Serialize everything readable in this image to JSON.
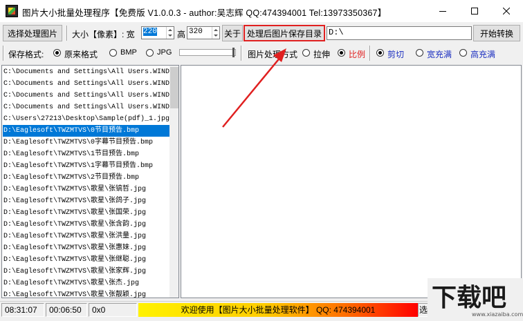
{
  "window": {
    "title": "图片大小批量处理程序【免费版 V1.0.0.3 - author:吴志辉  QQ:474394001 Tel:13973350367】",
    "controls": [
      "minimize",
      "maximize",
      "close"
    ]
  },
  "toolbar": {
    "choose_images_label": "选择处理图片",
    "size_label": "大小【像素】: 宽",
    "width_value": "220",
    "height_label": "高",
    "height_value": "320",
    "about_label": "关于",
    "output_dir_label": "处理后图片保存目录",
    "output_dir_value": "D:\\",
    "start_label": "开始转换"
  },
  "options": {
    "format_label": "保存格式:",
    "format_original": "原来格式",
    "format_bmp": "BMP",
    "format_jpg": "JPG",
    "selected_format": "原来格式",
    "method_label": "图片处理方式",
    "method_stretch": "拉伸",
    "method_ratio": "比例",
    "selected_method": "比例",
    "fill_crop": "剪切",
    "fill_width": "宽充满",
    "fill_height": "高充满",
    "selected_fill": "剪切"
  },
  "file_list": {
    "items": [
      "C:\\Documents and Settings\\All Users.WINDOWS",
      "C:\\Documents and Settings\\All Users.WINDOWS",
      "C:\\Documents and Settings\\All Users.WINDOWS",
      "C:\\Documents and Settings\\All Users.WINDOWS",
      "C:\\Users\\27213\\Desktop\\Sample(pdf)_1.jpg",
      "D:\\Eaglesoft\\TWZMTVS\\0节目预告.bmp",
      "D:\\Eaglesoft\\TWZMTVS\\0字幕节目预告.bmp",
      "D:\\Eaglesoft\\TWZMTVS\\1节目预告.bmp",
      "D:\\Eaglesoft\\TWZMTVS\\1字幕节目预告.bmp",
      "D:\\Eaglesoft\\TWZMTVS\\2节目预告.bmp",
      "D:\\Eaglesoft\\TWZMTVS\\歌星\\张镐哲.jpg",
      "D:\\Eaglesoft\\TWZMTVS\\歌星\\张鸽子.jpg",
      "D:\\Eaglesoft\\TWZMTVS\\歌星\\张国荣.jpg",
      "D:\\Eaglesoft\\TWZMTVS\\歌星\\张含韵.jpg",
      "D:\\Eaglesoft\\TWZMTVS\\歌星\\张洪量.jpg",
      "D:\\Eaglesoft\\TWZMTVS\\歌星\\张惠妹.jpg",
      "D:\\Eaglesoft\\TWZMTVS\\歌星\\张继聪.jpg",
      "D:\\Eaglesoft\\TWZMTVS\\歌星\\张家辉.jpg",
      "D:\\Eaglesoft\\TWZMTVS\\歌星\\张杰.jpg",
      "D:\\Eaglesoft\\TWZMTVS\\歌星\\张靓颖.jpg"
    ],
    "selected_index": 5
  },
  "status": {
    "time": "08:31:07",
    "elapsed": "00:06:50",
    "hex": "0x0",
    "welcome": "欢迎使用【图片大小批量处理软件】 QQ: 474394001",
    "trailing_label": "选"
  },
  "watermark": {
    "brand": "下载吧",
    "url": "www.xiazaiba.com"
  },
  "annotation": {
    "color": "#e02020"
  }
}
